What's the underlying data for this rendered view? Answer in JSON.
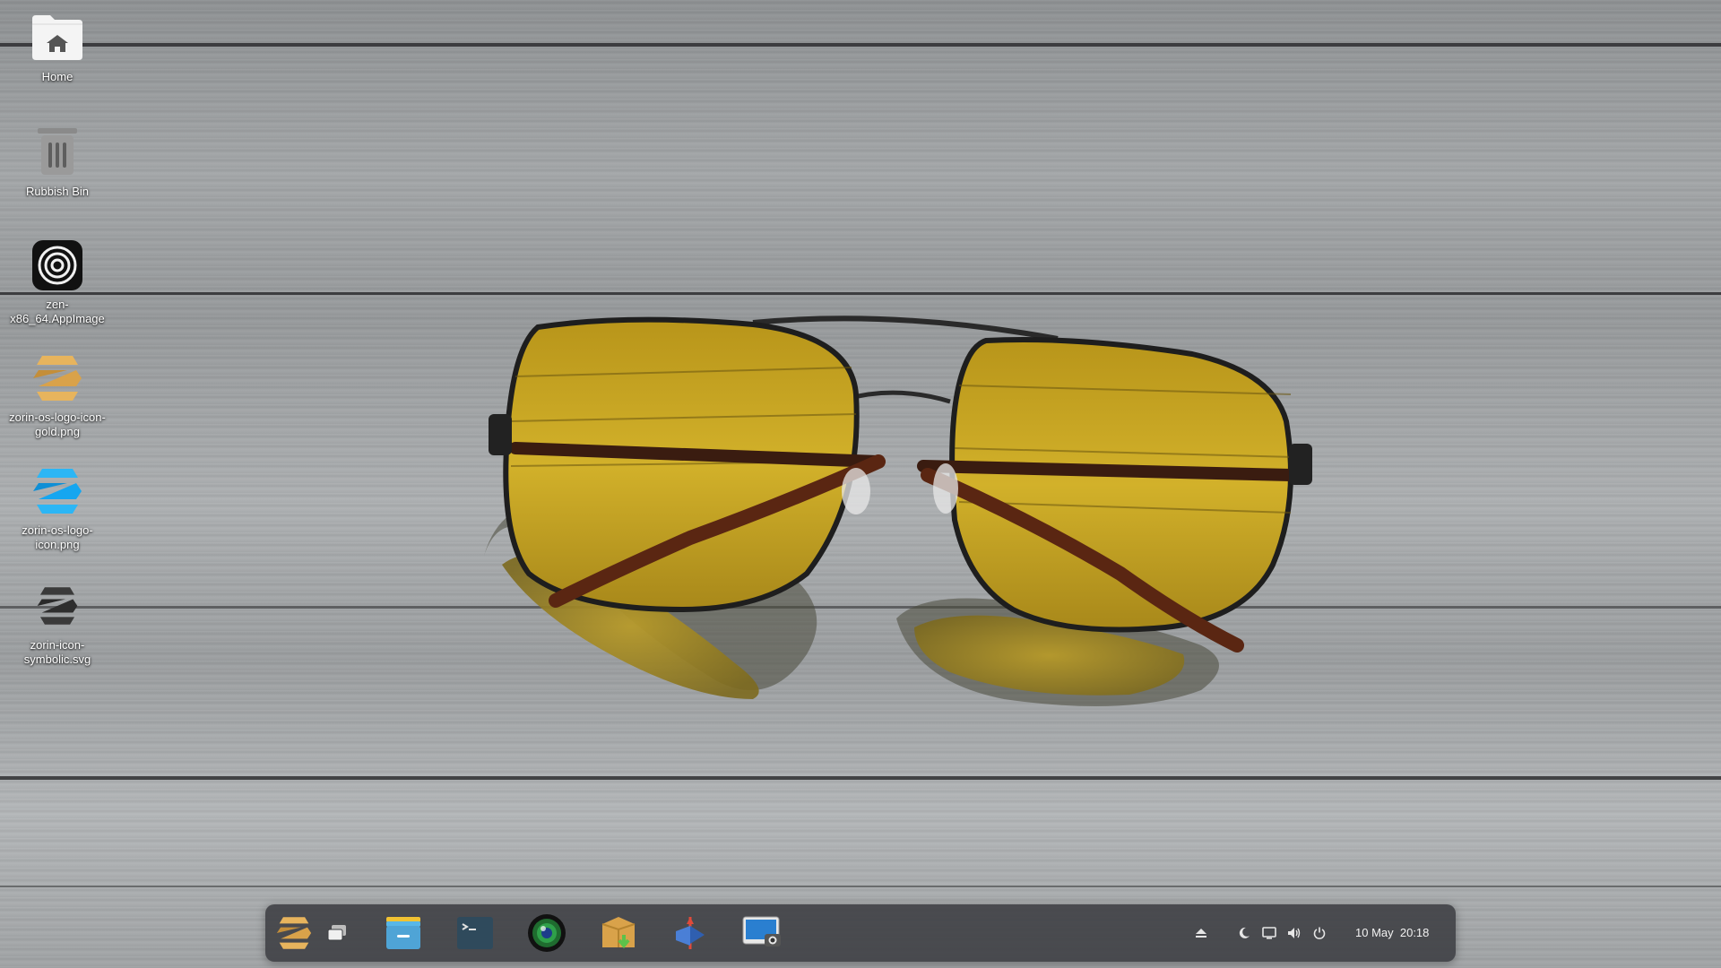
{
  "desktop": {
    "icons": [
      {
        "label": "Home",
        "icon": "home-folder-icon"
      },
      {
        "label": "Rubbish Bin",
        "icon": "trash-icon"
      },
      {
        "label": "zen-x86_64.AppImage",
        "icon": "zen-browser-icon"
      },
      {
        "label": "zorin-os-logo-icon-gold.png",
        "icon": "zorin-logo-gold-icon"
      },
      {
        "label": "zorin-os-logo-icon.png",
        "icon": "zorin-logo-blue-icon"
      },
      {
        "label": "zorin-icon-symbolic.svg",
        "icon": "zorin-logo-symbolic-icon"
      }
    ]
  },
  "taskbar": {
    "apps": [
      {
        "name": "zorin-menu",
        "icon": "zorin-menu-icon"
      },
      {
        "name": "workspaces",
        "icon": "workspace-switcher-icon"
      },
      {
        "name": "files",
        "icon": "files-icon"
      },
      {
        "name": "terminal",
        "icon": "terminal-icon"
      },
      {
        "name": "browser",
        "icon": "web-browser-icon"
      },
      {
        "name": "archive-manager",
        "icon": "archive-icon"
      },
      {
        "name": "media-app",
        "icon": "media-app-icon"
      },
      {
        "name": "screenshot",
        "icon": "screenshot-icon"
      }
    ],
    "tray": {
      "icons": [
        "eject-icon",
        "night-light-icon",
        "display-icon",
        "volume-icon",
        "power-icon"
      ],
      "clock": "10 May  20:18"
    }
  },
  "colors": {
    "zorin_blue": "#15a6f0",
    "zorin_gold": "#d9a24a",
    "lens_yellow": "#c9a81a",
    "taskbar_bg": "#3c3e42"
  }
}
